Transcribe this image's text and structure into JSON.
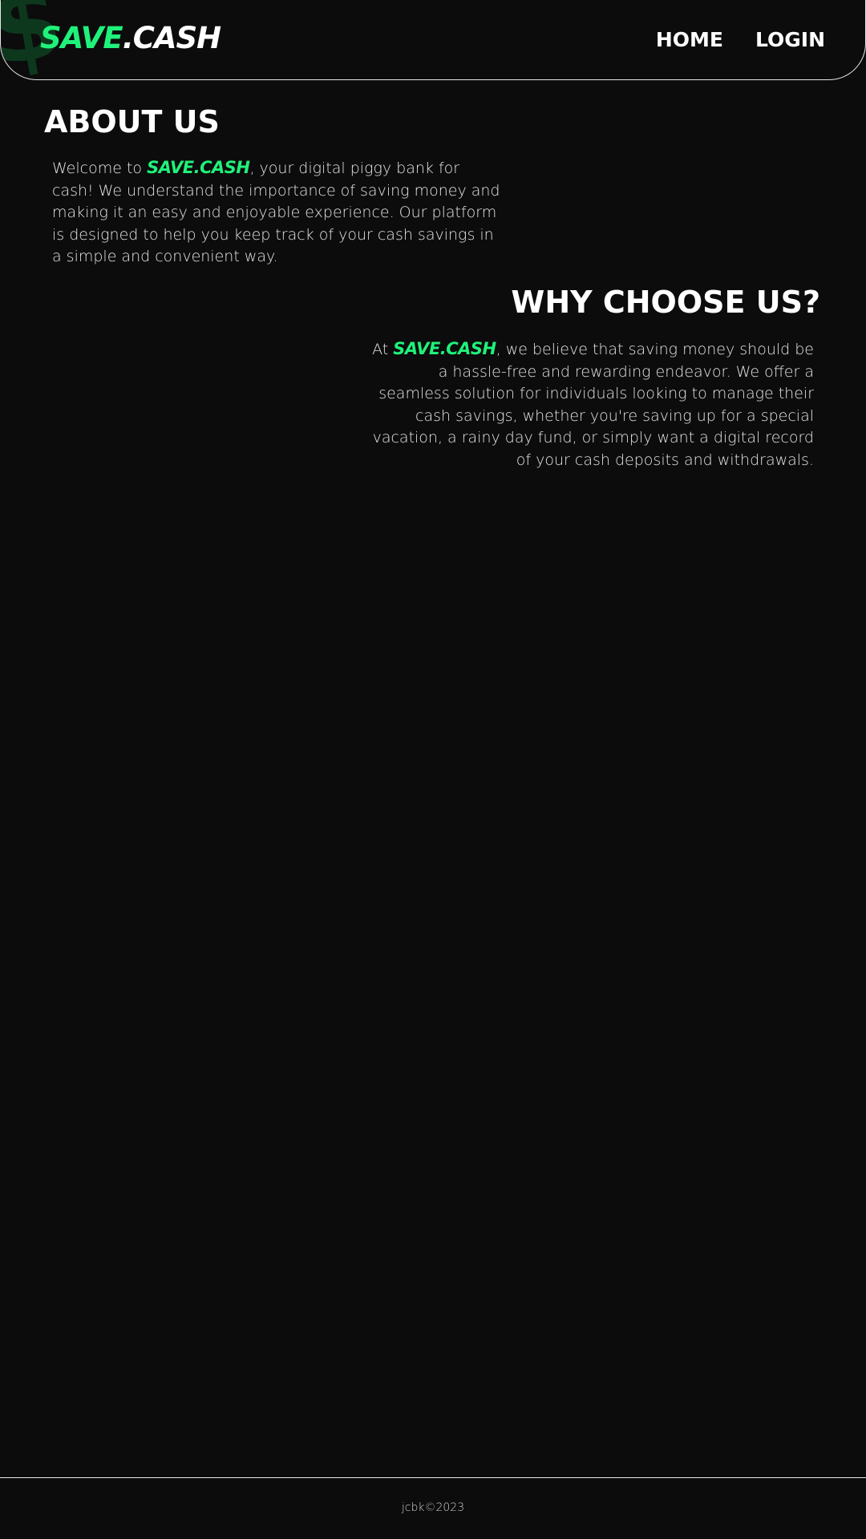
{
  "header": {
    "logo": {
      "part1": "SAVE",
      "part2": ".CASH"
    },
    "watermark_glyph": "$",
    "nav": [
      {
        "label": "HOME"
      },
      {
        "label": "LOGIN"
      }
    ]
  },
  "about": {
    "title": "ABOUT US",
    "text_before": "Welcome to ",
    "brand": "SAVE.CASH",
    "text_after": ", your digital piggy bank for cash! We understand the importance of saving money and making it an easy and enjoyable experience. Our platform is designed to help you keep track of your cash savings in a simple and convenient way."
  },
  "why": {
    "title": "WHY CHOOSE US?",
    "text_before": "At ",
    "brand": "SAVE.CASH",
    "text_after": ", we believe that saving money should be a hassle-free and rewarding endeavor. We offer a seamless solution for individuals looking to manage their cash savings, whether you're saving up for a special vacation, a rainy day fund, or simply want a digital record of your cash deposits and withdrawals."
  },
  "footer": {
    "text": "jcbk©2023"
  },
  "colors": {
    "background": "#0c0c0c",
    "accent": "#1ff27a",
    "text": "#ffffff"
  }
}
